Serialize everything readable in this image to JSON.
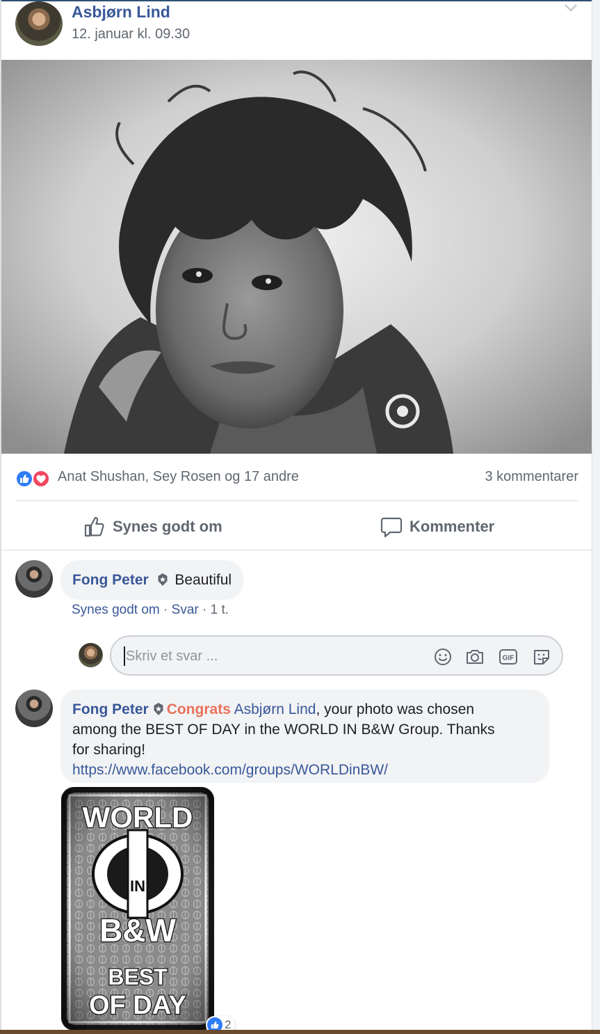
{
  "post": {
    "author": "Asbjørn Lind",
    "timestamp": "12. januar kl. 09.30",
    "photo_alt": "Black-and-white portrait of a child with tousled hair"
  },
  "reactions": {
    "reactor_summary": "Anat Shushan, Sey Rosen og 17 andre",
    "comment_count": "3 kommentarer",
    "icons": [
      "like-icon",
      "love-icon"
    ]
  },
  "actions": {
    "like_label": "Synes godt om",
    "comment_label": "Kommenter"
  },
  "comments": [
    {
      "author": "Fong Peter",
      "text": "Beautiful",
      "meta": {
        "like": "Synes godt om",
        "sep1": " · ",
        "reply": "Svar",
        "sep2": " · ",
        "time": "1 t."
      }
    },
    {
      "author": "Fong Peter",
      "highlight": "Congrats",
      "mention": "Asbjørn Lind",
      "text_line1_rest": ", your photo was chosen",
      "text_line2": "among the BEST OF DAY in the WORLD IN B&W Group. Thanks",
      "text_line3": "for sharing!",
      "link": "https://www.facebook.com/groups/WORLDinBW/",
      "sticker": {
        "line1": "WORLD",
        "line2": "IN",
        "line3": "B&W",
        "line4": "BEST",
        "line5": "OF DAY"
      },
      "reaction_count": "2"
    }
  ],
  "reply_box": {
    "placeholder": "Skriv et svar ...",
    "icons": [
      "emoji-icon",
      "camera-icon",
      "gif-icon",
      "sticker-icon"
    ]
  },
  "colors": {
    "link_blue": "#385898",
    "meta_gray": "#606770",
    "like_blue": "#2e7cf6",
    "love_red": "#f0465f",
    "congrats_orange": "#e9715b"
  }
}
